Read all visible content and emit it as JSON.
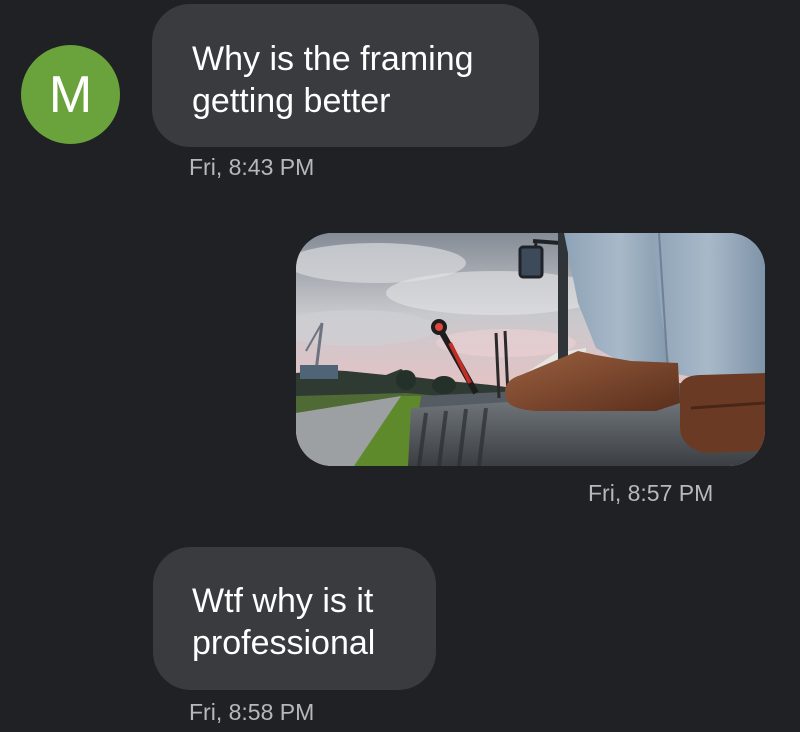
{
  "contact": {
    "avatar_letter": "M",
    "avatar_color": "#6aa33c"
  },
  "messages": [
    {
      "direction": "incoming",
      "lines": [
        "Why is the framing",
        "getting better"
      ],
      "timestamp": "Fri, 8:43 PM"
    },
    {
      "direction": "outgoing",
      "type": "photo",
      "timestamp": "Fri, 8:57 PM"
    },
    {
      "direction": "incoming",
      "lines": [
        "Wtf why is it",
        "professional"
      ],
      "timestamp": "Fri, 8:58 PM"
    }
  ],
  "theme": {
    "background": "#202124",
    "bubble": "#3a3b3f",
    "text": "#ffffff",
    "timestamp": "#b7b8bc"
  }
}
